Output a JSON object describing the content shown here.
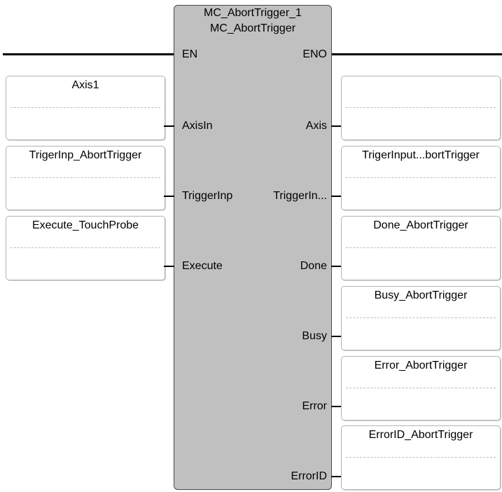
{
  "block": {
    "instance_name": "MC_AbortTrigger_1",
    "type_name": "MC_AbortTrigger",
    "en_label": "EN",
    "eno_label": "ENO"
  },
  "inputs": [
    {
      "pin": "AxisIn",
      "variable": "Axis1"
    },
    {
      "pin": "TriggerInp",
      "variable": "TrigerInp_AbortTrigger"
    },
    {
      "pin": "Execute",
      "variable": "Execute_TouchProbe"
    }
  ],
  "outputs": [
    {
      "pin": "Axis",
      "variable": ""
    },
    {
      "pin": "TriggerIn...",
      "variable": "TrigerInput...bortTrigger"
    },
    {
      "pin": "Done",
      "variable": "Done_AbortTrigger"
    },
    {
      "pin": "Busy",
      "variable": "Busy_AbortTrigger"
    },
    {
      "pin": "Error",
      "variable": "Error_AbortTrigger"
    },
    {
      "pin": "ErrorID",
      "variable": "ErrorID_AbortTrigger"
    }
  ]
}
